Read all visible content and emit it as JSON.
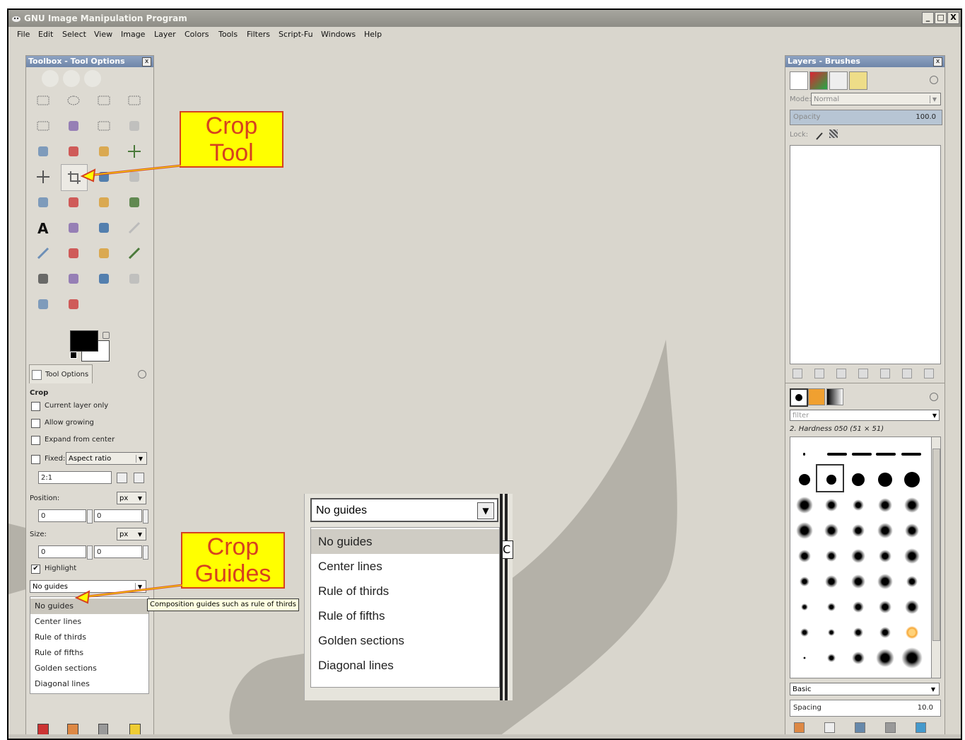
{
  "window": {
    "title": "GNU Image Manipulation Program",
    "controls": [
      "_",
      "□",
      "X"
    ]
  },
  "menu": {
    "items": [
      "File",
      "Edit",
      "Select",
      "View",
      "Image",
      "Layer",
      "Colors",
      "Tools",
      "Filters",
      "Script-Fu",
      "Windows",
      "Help"
    ]
  },
  "toolbox": {
    "title": "Toolbox - Tool Options",
    "tab_label": "Tool Options",
    "tool_icons": [
      "rect-select",
      "ellipse-select",
      "free-select",
      "fuzzy-select",
      "color-select",
      "scissors",
      "foreground-select",
      "paths",
      "color-picker",
      "zoom",
      "measure",
      "move",
      "align",
      "crop",
      "rotate",
      "scale",
      "shear",
      "perspective",
      "flip",
      "cage",
      "text",
      "heal",
      "blend",
      "pencil",
      "paintbrush",
      "eraser",
      "airbrush",
      "ink",
      "clone",
      "heal-spot",
      "perspective-clone",
      "blur",
      "smudge",
      "dodge-burn"
    ]
  },
  "options": {
    "section": "Crop",
    "current_layer_only": "Current layer only",
    "allow_growing": "Allow growing",
    "expand_from_center": "Expand from center",
    "fixed_label": "Fixed:",
    "fixed_value": "Aspect ratio",
    "ratio_value": "2:1",
    "position_label": "Position:",
    "position_unit": "px",
    "position_x": "0",
    "position_y": "0",
    "size_label": "Size:",
    "size_unit": "px",
    "size_w": "0",
    "size_h": "0",
    "highlight": "Highlight",
    "guides_value": "No guides",
    "guides_options": [
      "No guides",
      "Center lines",
      "Rule of thirds",
      "Rule of fifths",
      "Golden sections",
      "Diagonal lines"
    ],
    "tooltip": "Composition guides such as rule of thirds"
  },
  "callouts": {
    "crop_tool": "Crop Tool",
    "crop_guides": "Crop Guides"
  },
  "zoom_list": {
    "selected": "No guides",
    "options": [
      "No guides",
      "Center lines",
      "Rule of thirds",
      "Rule of fifths",
      "Golden sections",
      "Diagonal lines"
    ],
    "peek": "C"
  },
  "layers": {
    "title": "Layers - Brushes",
    "mode_label": "Mode:",
    "mode_value": "Normal",
    "opacity_label": "Opacity",
    "opacity_value": "100.0",
    "lock_label": "Lock:"
  },
  "brushes": {
    "filter_placeholder": "filter",
    "current_brush": "2. Hardness 050 (51 × 51)",
    "preset": "Basic",
    "spacing_label": "Spacing",
    "spacing_value": "10.0"
  },
  "colors": {
    "accent_red": "#d6411f",
    "callout_fill": "#ffff00",
    "canvas_bg": "#d9d6cd"
  }
}
